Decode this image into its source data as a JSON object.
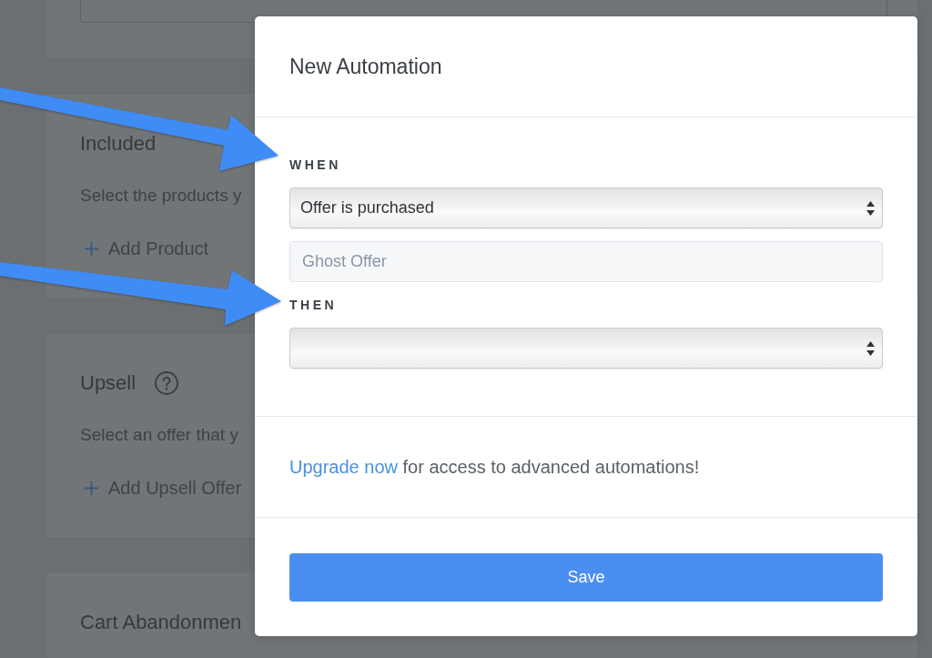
{
  "background_page": {
    "cards": [
      {
        "kind": "field"
      },
      {
        "kind": "section",
        "title": "Included",
        "help": false,
        "description": "Select the products y",
        "action": "Add Product"
      },
      {
        "kind": "section",
        "title": "Upsell",
        "help": true,
        "description": "Select an offer that y",
        "action": "Add Upsell Offer"
      },
      {
        "kind": "section",
        "title": "Cart Abandonmen",
        "help": false
      }
    ]
  },
  "modal": {
    "title": "New Automation",
    "form": [
      {
        "kind": "section_label",
        "text": "WHEN"
      },
      {
        "kind": "select",
        "value": "Offer is purchased"
      },
      {
        "kind": "text_field",
        "value": "Ghost Offer",
        "disabled": true
      },
      {
        "kind": "section_label",
        "text": "THEN"
      },
      {
        "kind": "select"
      }
    ],
    "notice": {
      "link": "Upgrade now",
      "text": "for access to advanced automations!"
    },
    "buttons": [
      {
        "kind": "primary",
        "label": "Save"
      }
    ]
  }
}
